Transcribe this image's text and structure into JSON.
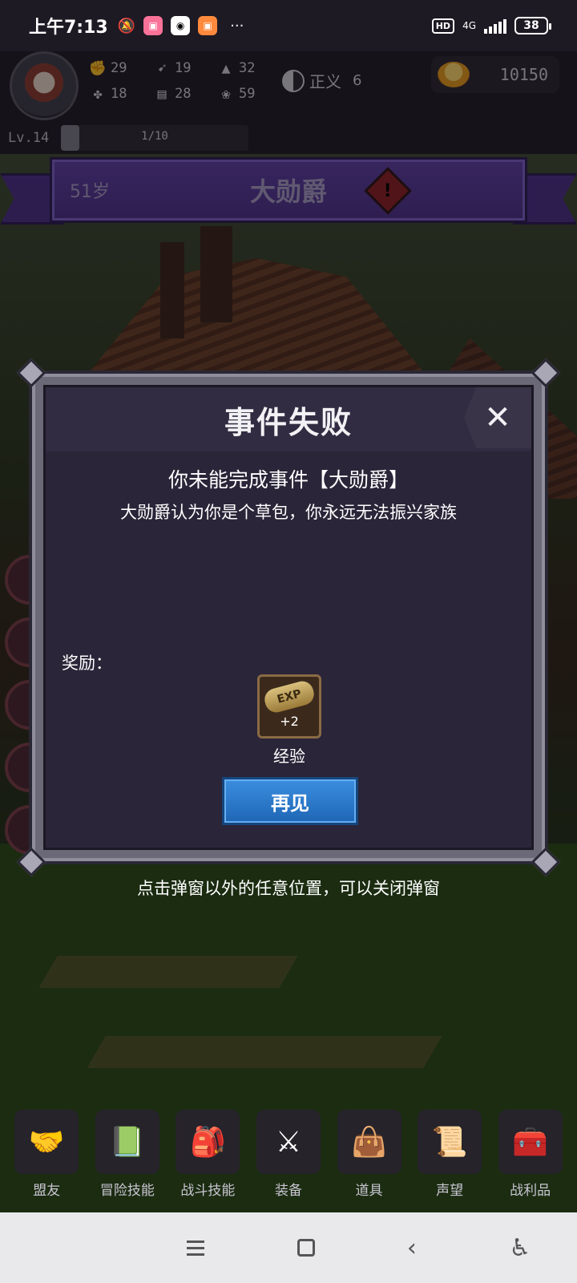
{
  "status_bar": {
    "time": "上午7:13",
    "more": "···",
    "hd": "HD",
    "network": "4G",
    "battery": "38"
  },
  "player": {
    "stats": [
      {
        "icon": "fist-icon",
        "glyph": "✊",
        "value": "29"
      },
      {
        "icon": "boot-icon",
        "glyph": "➹",
        "value": "19"
      },
      {
        "icon": "wizard-hat-icon",
        "glyph": "▲",
        "value": "32"
      },
      {
        "icon": "clover-icon",
        "glyph": "✤",
        "value": "18"
      },
      {
        "icon": "book-icon",
        "glyph": "▤",
        "value": "28"
      },
      {
        "icon": "lotus-icon",
        "glyph": "❀",
        "value": "59"
      }
    ],
    "alignment_label": "正义",
    "alignment_value": "6",
    "gold": "10150",
    "level_label": "Lv.14",
    "level_progress_text": "1/10",
    "level_progress": 0.1
  },
  "event": {
    "age": "51岁",
    "title": "大勋爵"
  },
  "modal": {
    "title": "事件失败",
    "close": "✕",
    "message": "你未能完成事件【大勋爵】",
    "detail": "大勋爵认为你是个草包，你永远无法振兴家族",
    "reward_label": "奖励：",
    "reward": {
      "icon_text": "EXP",
      "amount": "+2",
      "name": "经验"
    },
    "button": "再见"
  },
  "hint": "点击弹窗以外的任意位置，可以关闭弹窗",
  "tabs": [
    {
      "label": "盟友",
      "icon": "handshake-icon",
      "glyph": "🤝"
    },
    {
      "label": "冒险技能",
      "icon": "spellbook-icon",
      "glyph": "📗"
    },
    {
      "label": "战斗技能",
      "icon": "backpack-icon",
      "glyph": "🎒"
    },
    {
      "label": "装备",
      "icon": "crossed-swords-icon",
      "glyph": "⚔"
    },
    {
      "label": "道具",
      "icon": "pouch-icon",
      "glyph": "👜"
    },
    {
      "label": "声望",
      "icon": "scroll-icon",
      "glyph": "📜"
    },
    {
      "label": "战利品",
      "icon": "treasure-chest-icon",
      "glyph": "🧰"
    }
  ]
}
